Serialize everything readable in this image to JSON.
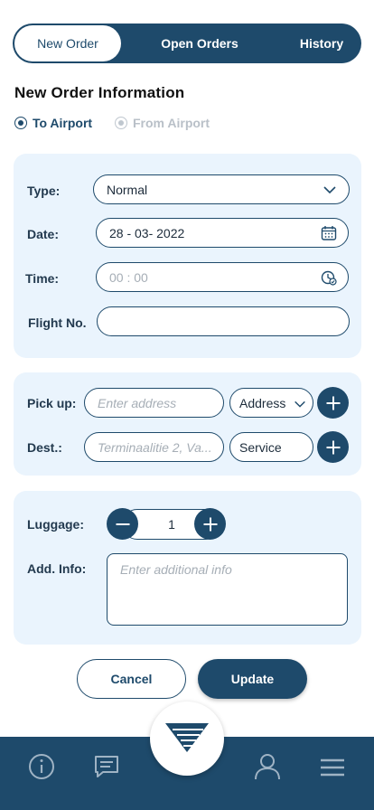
{
  "tabs": [
    {
      "label": "New Order",
      "active": true
    },
    {
      "label": "Open Orders",
      "active": false
    },
    {
      "label": "History",
      "active": false
    }
  ],
  "title": "New Order Information",
  "direction": {
    "options": [
      {
        "label": "To Airport",
        "selected": true,
        "enabled": true
      },
      {
        "label": "From Airport",
        "selected": false,
        "enabled": false
      }
    ]
  },
  "order": {
    "type_label": "Type:",
    "type_value": "Normal",
    "date_label": "Date:",
    "date_value": "28 - 03- 2022",
    "time_label": "Time:",
    "time_value": "00 : 00",
    "flight_label": "Flight No.",
    "flight_value": ""
  },
  "route": {
    "pickup_label": "Pick up:",
    "pickup_placeholder": "Enter address",
    "pickup_kind": "Address",
    "dest_label": "Dest.:",
    "dest_placeholder": "Terminaalitie 2, Va...",
    "dest_kind": "Service"
  },
  "extras": {
    "luggage_label": "Luggage:",
    "luggage_count": 1,
    "info_label": "Add. Info:",
    "info_placeholder": "Enter additional info"
  },
  "actions": {
    "cancel_label": "Cancel",
    "update_label": "Update"
  },
  "bottom_nav": {
    "icons": [
      "info-icon",
      "chat-icon",
      "logo-icon",
      "user-icon",
      "menu-icon"
    ]
  },
  "colors": {
    "primary": "#1e4a6b",
    "card_bg": "#eaf4fd",
    "placeholder": "#a6aeb6",
    "disabled": "#b9c0c8"
  }
}
